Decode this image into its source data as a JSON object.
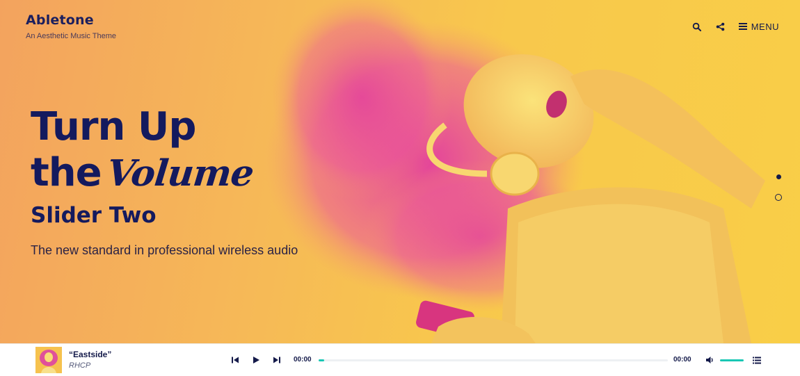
{
  "brand": {
    "title": "Abletone",
    "tagline": "An Aesthetic Music Theme"
  },
  "nav": {
    "menu_label": "MENU",
    "icons": [
      "search-icon",
      "share-icon",
      "hamburger-icon"
    ]
  },
  "slide": {
    "headline_line1": "Turn Up",
    "headline_line2_a": "the",
    "headline_line2_script": "Volume",
    "title": "Slider Two",
    "subtitle": "The new standard in professional wireless audio",
    "active_index": 0,
    "count": 2
  },
  "player": {
    "track_title": "“Eastside”",
    "artist": "RHCP",
    "current_time": "00:00",
    "total_time": "00:00",
    "progress_fraction": 0.016,
    "volume_fraction": 1.0
  },
  "colors": {
    "navy": "#141a5e",
    "accent": "#19c7b4",
    "magenta": "#e0329f",
    "yellow": "#f8c84c"
  }
}
